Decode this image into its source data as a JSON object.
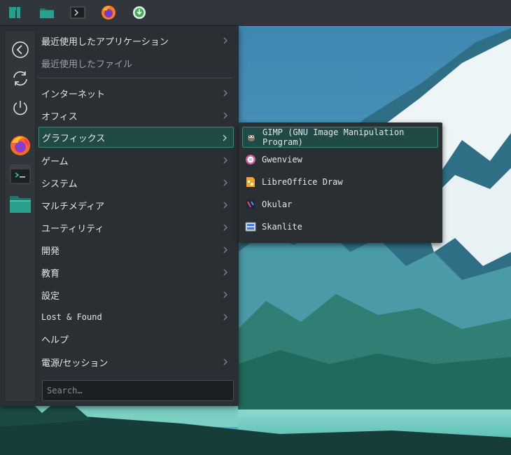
{
  "colors": {
    "accent": "#2e8b7c",
    "selection": "#1f4a45",
    "panel": "#30363b",
    "menu_bg": "#2a2f33"
  },
  "panel": {
    "items": [
      {
        "icon": "manjaro-logo-icon"
      },
      {
        "icon": "file-manager-icon"
      },
      {
        "icon": "terminal-icon"
      },
      {
        "icon": "firefox-icon"
      },
      {
        "icon": "software-update-icon"
      }
    ]
  },
  "favorites": {
    "actions": [
      {
        "icon": "back-arrow-icon"
      },
      {
        "icon": "refresh-icon"
      },
      {
        "icon": "power-icon"
      }
    ],
    "apps": [
      {
        "icon": "firefox-icon"
      },
      {
        "icon": "terminal-icon"
      },
      {
        "icon": "file-manager-icon"
      }
    ]
  },
  "menu": {
    "recent_apps": "最近使用したアプリケーション",
    "recent_files": "最近使用したファイル",
    "categories": [
      "インターネット",
      "オフィス",
      "グラフィックス",
      "ゲーム",
      "システム",
      "マルチメディア",
      "ユーティリティ",
      "開発",
      "教育",
      "設定",
      "Lost & Found",
      "ヘルプ",
      "電源/セッション"
    ],
    "selected_category": "グラフィックス"
  },
  "search": {
    "placeholder": "Search…",
    "value": ""
  },
  "submenu": {
    "items": [
      {
        "label": "GIMP (GNU Image Manipulation Program)",
        "icon": "gimp-icon"
      },
      {
        "label": "Gwenview",
        "icon": "gwenview-icon"
      },
      {
        "label": "LibreOffice Draw",
        "icon": "libreoffice-draw-icon"
      },
      {
        "label": "Okular",
        "icon": "okular-icon"
      },
      {
        "label": "Skanlite",
        "icon": "skanlite-icon"
      }
    ]
  }
}
